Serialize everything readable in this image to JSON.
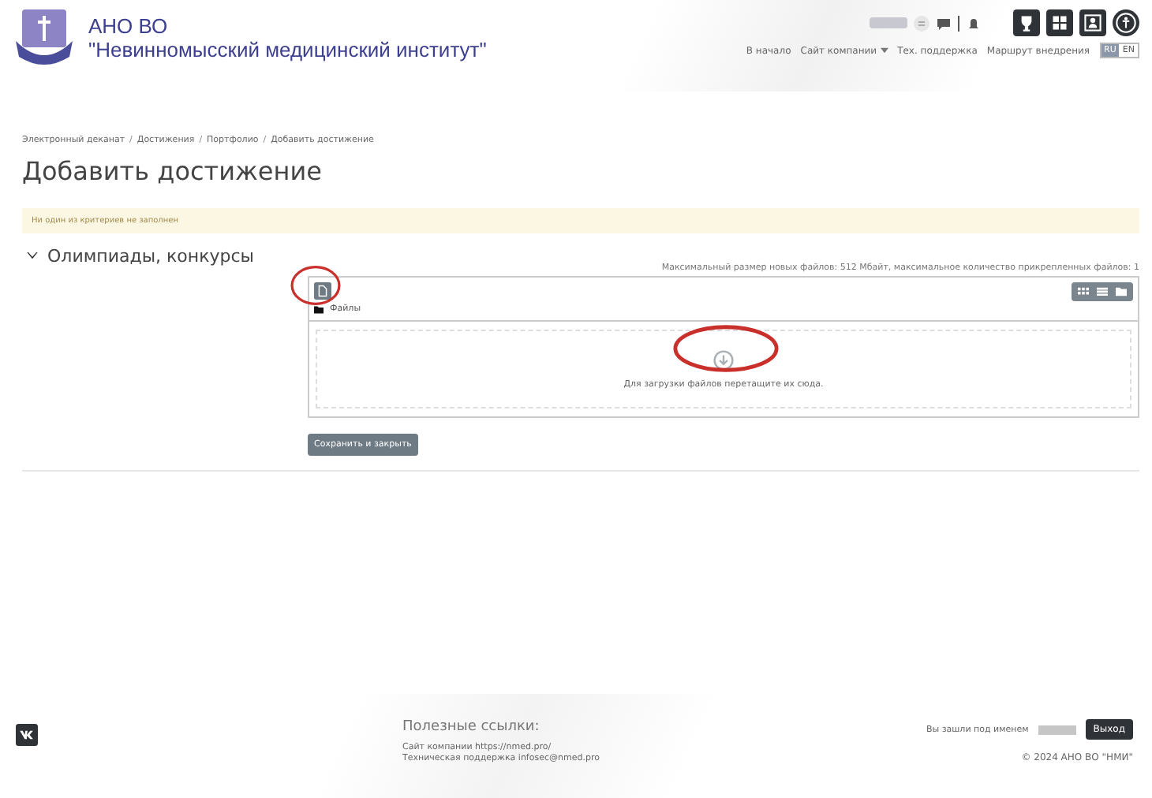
{
  "header": {
    "org_line1": "АНО ВО",
    "org_line2": "\"Невинномысский медицинский институт\"",
    "nav": [
      {
        "label": "В начало",
        "dropdown": false
      },
      {
        "label": "Сайт компании",
        "dropdown": true
      },
      {
        "label": "Тех. поддержка",
        "dropdown": false
      },
      {
        "label": "Маршрут внедрения",
        "dropdown": false
      }
    ],
    "languages": [
      {
        "label": "RU",
        "selected": true
      },
      {
        "label": "EN",
        "selected": false
      }
    ]
  },
  "breadcrumb": {
    "separator": "/",
    "items": [
      "Электронный деканат",
      "Достижения",
      "Портфолио",
      "Добавить достижение"
    ]
  },
  "page_title": "Добавить достижение",
  "alert": "Ни один из критериев не заполнен",
  "section": {
    "title": "Олимпиады, конкурсы",
    "expanded": true
  },
  "filepicker": {
    "limits": "Максимальный размер новых файлов: 512 Мбайт, максимальное количество прикрепленных файлов: 1",
    "folder": "Файлы",
    "drop_hint": "Для загрузки файлов перетащите их сюда."
  },
  "save_button": "Сохранить и закрыть",
  "footer": {
    "links_title": "Полезные ссылки:",
    "links": [
      "Сайт компании https://nmed.pro/",
      "Техническая поддержка infosec@nmed.pro"
    ],
    "logged_in": "Вы зашли под именем",
    "logout": "Выход",
    "copyright": "© 2024 АНО ВО \"НМИ\""
  }
}
